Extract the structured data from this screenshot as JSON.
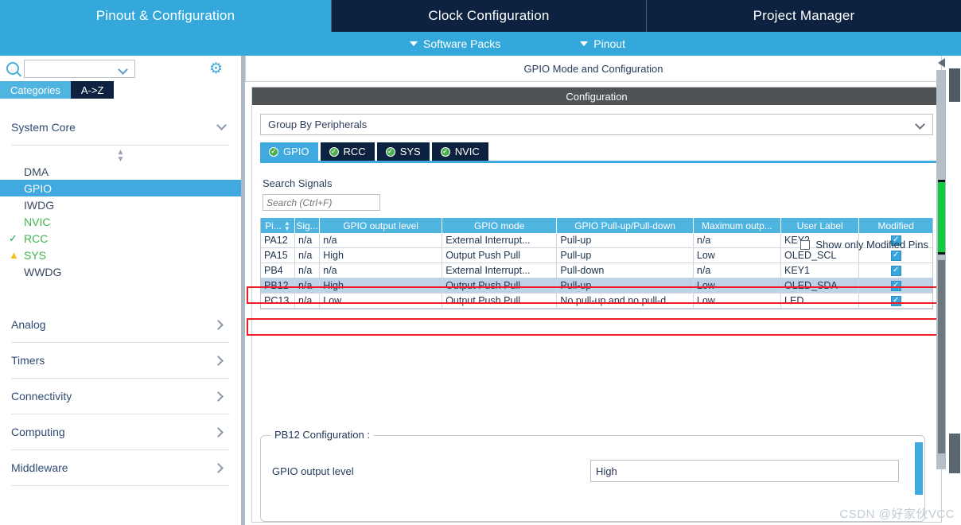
{
  "window": {
    "main_tabs": [
      {
        "label": "Pinout & Configuration",
        "active": true
      },
      {
        "label": "Clock Configuration",
        "active": false
      },
      {
        "label": "Project Manager",
        "active": false
      }
    ],
    "sub_tabs": [
      {
        "label": "Software Packs",
        "icon": "chevron-down-icon"
      },
      {
        "label": "Pinout",
        "icon": "chevron-down-icon"
      }
    ]
  },
  "sidebar": {
    "search_placeholder": "",
    "search_icon": "search-icon",
    "settings_icon": "gear-icon",
    "view_tabs": [
      {
        "label": "Categories",
        "selected": true
      },
      {
        "label": "A->Z",
        "selected": false
      }
    ],
    "sections": [
      {
        "label": "System Core",
        "expanded": true,
        "icon": "chevron-down-icon"
      },
      {
        "label": "Analog",
        "expanded": false,
        "icon": "chevron-right-icon"
      },
      {
        "label": "Timers",
        "expanded": false,
        "icon": "chevron-right-icon"
      },
      {
        "label": "Connectivity",
        "expanded": false,
        "icon": "chevron-right-icon"
      },
      {
        "label": "Computing",
        "expanded": false,
        "icon": "chevron-right-icon"
      },
      {
        "label": "Middleware",
        "expanded": false,
        "icon": "chevron-right-icon"
      }
    ],
    "peripherals": [
      {
        "label": "DMA",
        "selected": false,
        "status": "none",
        "color": "#3a4a5e"
      },
      {
        "label": "GPIO",
        "selected": true,
        "status": "none",
        "color": "#ffffff"
      },
      {
        "label": "IWDG",
        "selected": false,
        "status": "none",
        "color": "#3a4a5e"
      },
      {
        "label": "NVIC",
        "selected": false,
        "status": "none",
        "color": "#3fb54a"
      },
      {
        "label": "RCC",
        "selected": false,
        "status": "check",
        "color": "#3fb54a"
      },
      {
        "label": "SYS",
        "selected": false,
        "status": "warning",
        "color": "#3fb54a"
      },
      {
        "label": "WWDG",
        "selected": false,
        "status": "none",
        "color": "#3a4a5e"
      }
    ]
  },
  "panel": {
    "mode_header": "GPIO Mode and Configuration",
    "configuration_title": "Configuration",
    "group_by": "Group By Peripherals",
    "peripheral_tabs": [
      {
        "label": "GPIO",
        "active": true,
        "icon": "check-circle-icon"
      },
      {
        "label": "RCC",
        "active": false,
        "icon": "check-circle-icon"
      },
      {
        "label": "SYS",
        "active": false,
        "icon": "check-circle-icon"
      },
      {
        "label": "NVIC",
        "active": false,
        "icon": "check-circle-icon"
      }
    ],
    "search_signals_label": "Search Signals",
    "search_signals_placeholder": "Search (Ctrl+F)",
    "show_modified_label": "Show only Modified Pins",
    "show_modified_checked": false,
    "table": {
      "columns": [
        "Pi...",
        "Sig...",
        "GPIO output level",
        "GPIO mode",
        "GPIO Pull-up/Pull-down",
        "Maximum outp...",
        "User Label",
        "Modified"
      ],
      "sort_column": "Pi...",
      "rows": [
        {
          "pin": "PA12",
          "signal": "n/a",
          "output_level": "n/a",
          "mode": "External Interrupt...",
          "pull": "Pull-up",
          "max_output": "n/a",
          "user_label": "KEY2",
          "modified": true,
          "selected": false,
          "highlighted": false
        },
        {
          "pin": "PA15",
          "signal": "n/a",
          "output_level": "High",
          "mode": "Output Push Pull",
          "pull": "Pull-up",
          "max_output": "Low",
          "user_label": "OLED_SCL",
          "modified": true,
          "selected": false,
          "highlighted": true
        },
        {
          "pin": "PB4",
          "signal": "n/a",
          "output_level": "n/a",
          "mode": "External Interrupt...",
          "pull": "Pull-down",
          "max_output": "n/a",
          "user_label": "KEY1",
          "modified": true,
          "selected": false,
          "highlighted": false
        },
        {
          "pin": "PB12",
          "signal": "n/a",
          "output_level": "High",
          "mode": "Output Push Pull",
          "pull": "Pull-up",
          "max_output": "Low",
          "user_label": "OLED_SDA",
          "modified": true,
          "selected": true,
          "highlighted": true
        },
        {
          "pin": "PC13...",
          "signal": "n/a",
          "output_level": "Low",
          "mode": "Output Push Pull",
          "pull": "No pull-up and no pull-d...",
          "max_output": "Low",
          "user_label": "LED",
          "modified": true,
          "selected": false,
          "highlighted": false
        }
      ]
    },
    "pin_config": {
      "legend": "PB12 Configuration :",
      "rows": [
        {
          "label": "GPIO output level",
          "value": "High"
        }
      ]
    }
  },
  "watermark": "CSDN @好家伙VCC",
  "colors": {
    "accent_blue": "#34a8da",
    "dark_navy": "#0d2240",
    "table_header": "#4fb4e0",
    "selected_row": "#bdd2e6",
    "highlight_red": "#ee1c23",
    "status_green": "#3fb54a",
    "warning_yellow": "#f2c21a",
    "scroll_green": "#12c942"
  }
}
